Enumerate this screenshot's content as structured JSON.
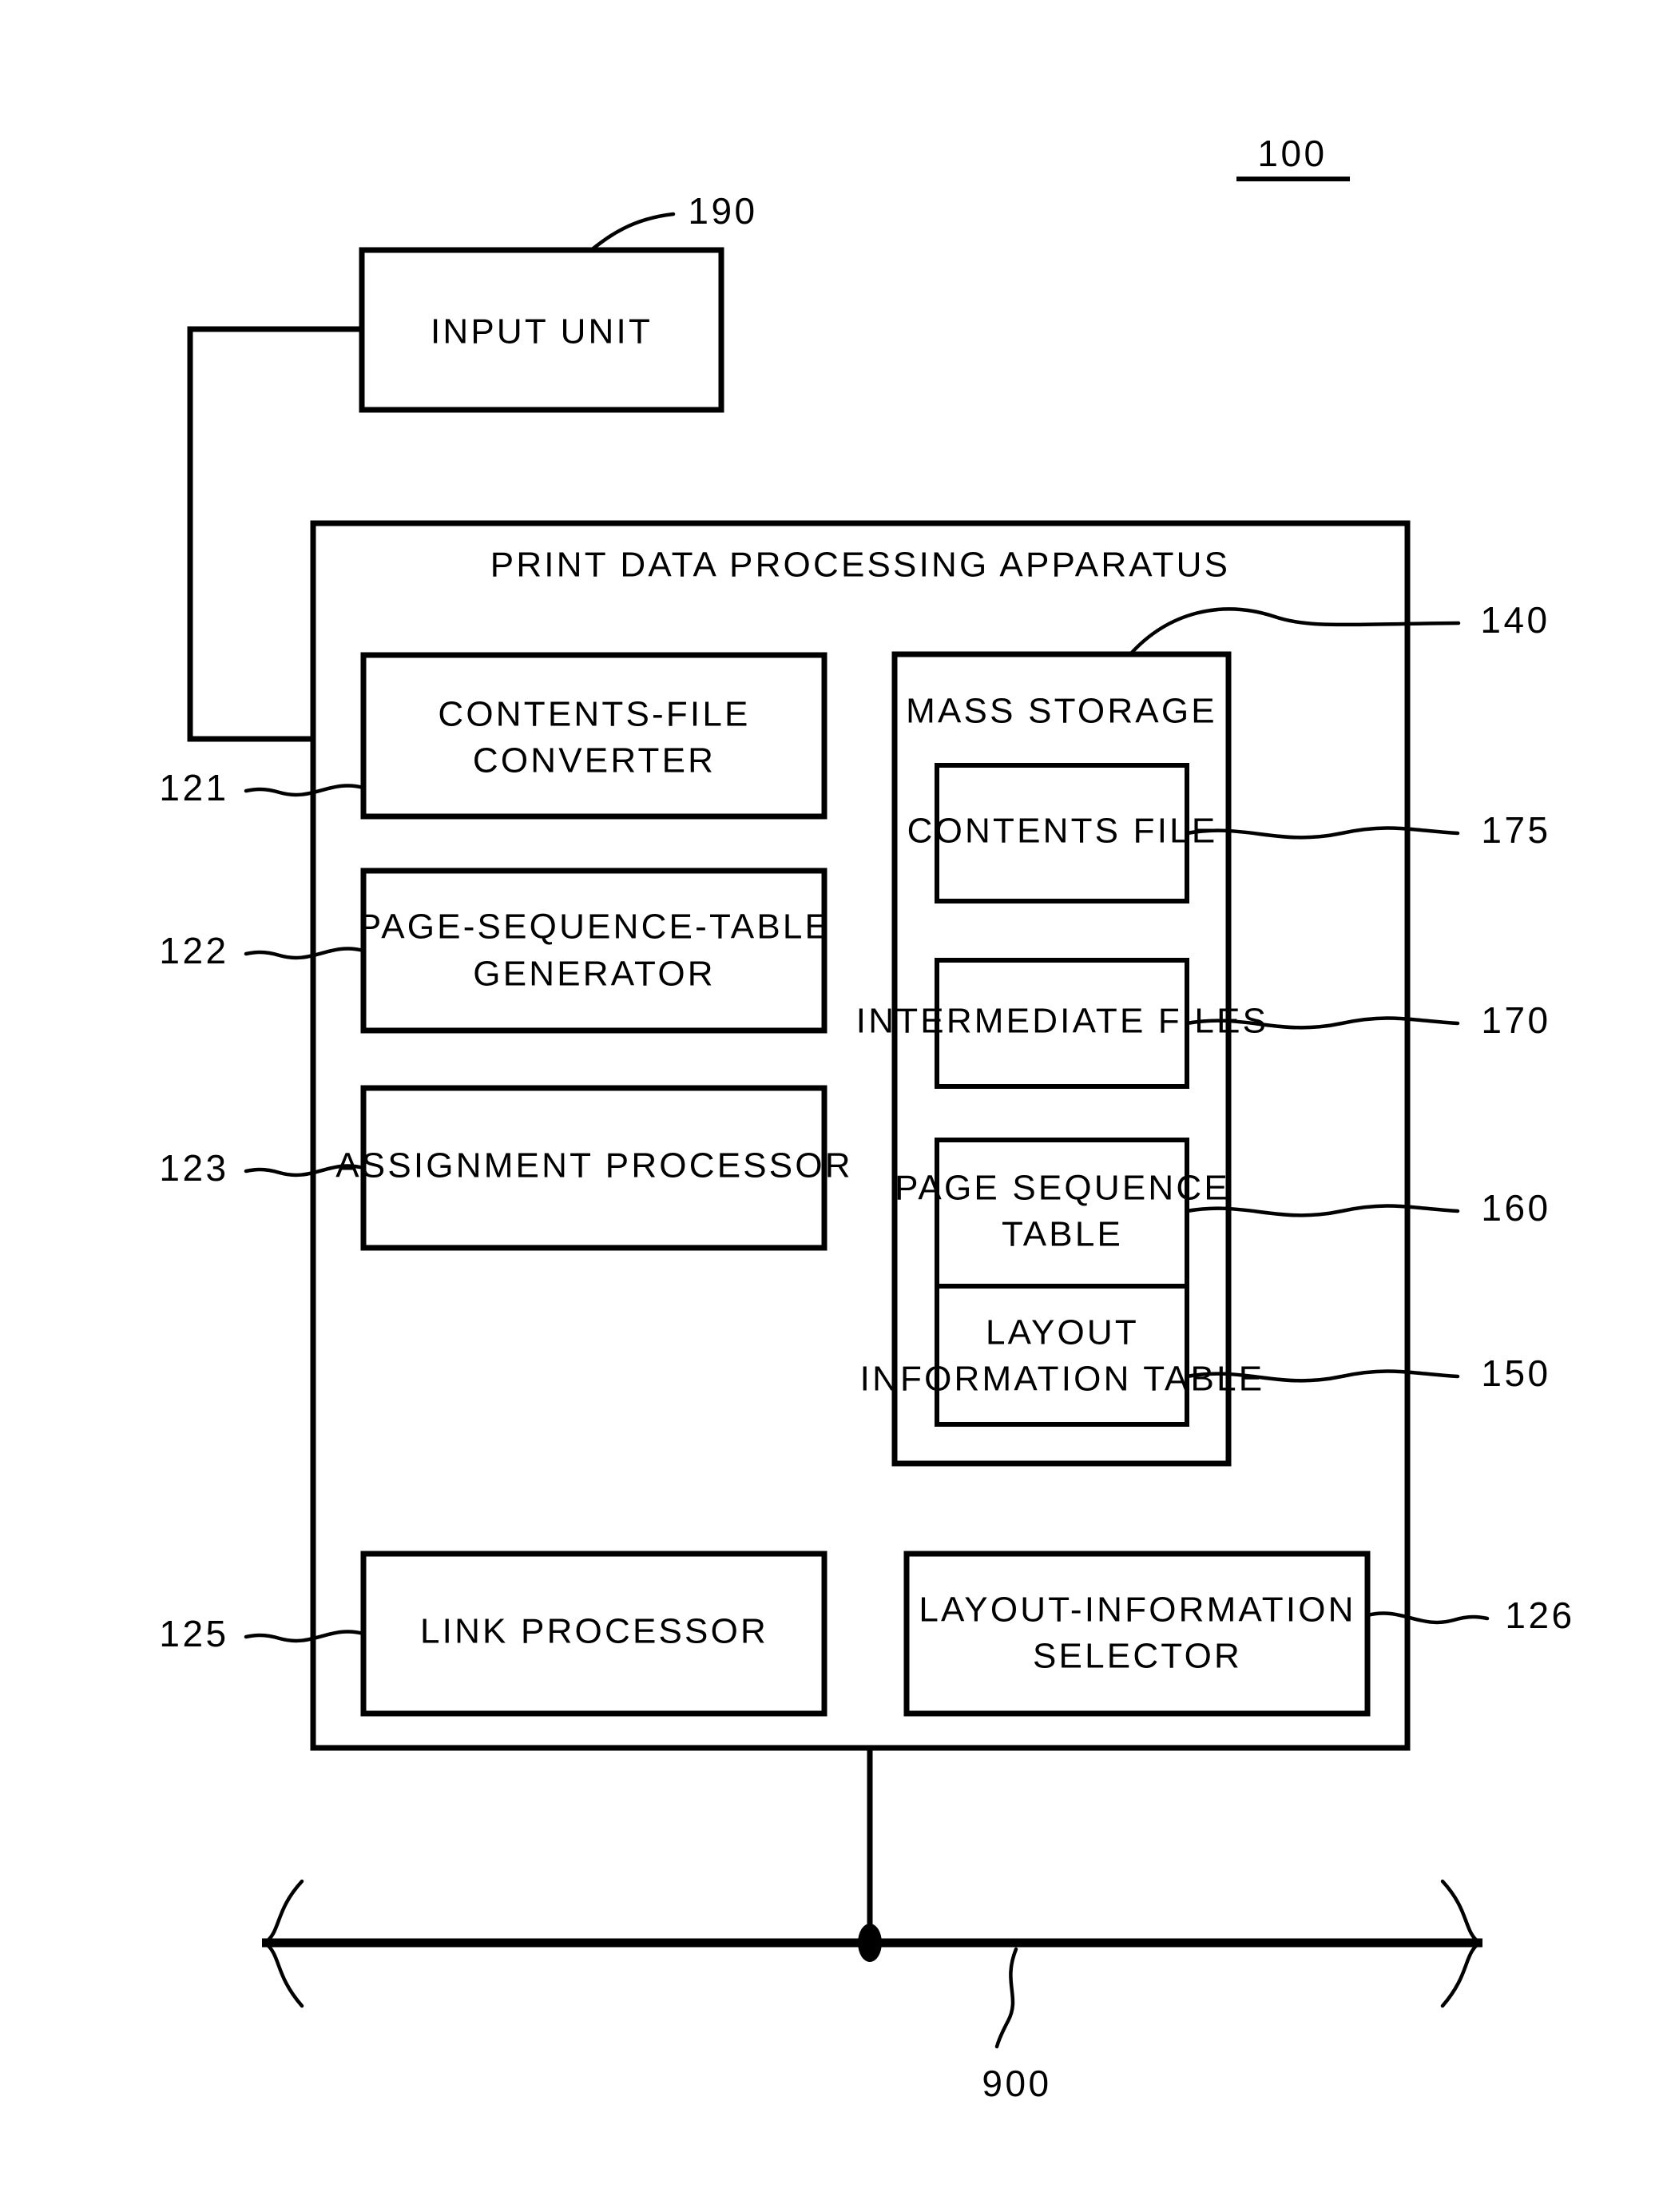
{
  "figure": {
    "figure_reference": "100",
    "bus_reference": "900",
    "input_unit": {
      "label": "INPUT UNIT",
      "reference": "190"
    },
    "apparatus": {
      "title": "PRINT DATA PROCESSING APPARATUS",
      "modules": [
        {
          "label_line1": "CONTENTS-FILE",
          "label_line2": "CONVERTER",
          "reference": "121"
        },
        {
          "label_line1": "PAGE-SEQUENCE-TABLE",
          "label_line2": "GENERATOR",
          "reference": "122"
        },
        {
          "label_line1": "ASSIGNMENT PROCESSOR",
          "label_line2": "",
          "reference": "123"
        },
        {
          "label_line1": "LINK PROCESSOR",
          "label_line2": "",
          "reference": "125"
        },
        {
          "label_line1": "LAYOUT-INFORMATION",
          "label_line2": "SELECTOR",
          "reference": "126"
        }
      ],
      "mass_storage": {
        "label": "MASS STORAGE",
        "reference": "140",
        "items": [
          {
            "label_line1": "CONTENTS FILE",
            "label_line2": "",
            "reference": "175"
          },
          {
            "label_line1": "INTERMEDIATE FILES",
            "label_line2": "",
            "reference": "170"
          },
          {
            "label_line1": "PAGE SEQUENCE",
            "label_line2": "TABLE",
            "reference": "160"
          },
          {
            "label_line1": "LAYOUT",
            "label_line2": "INFORMATION TABLE",
            "reference": "150"
          }
        ]
      }
    },
    "colors": {
      "ink": "#000000",
      "paper": "#ffffff"
    }
  }
}
